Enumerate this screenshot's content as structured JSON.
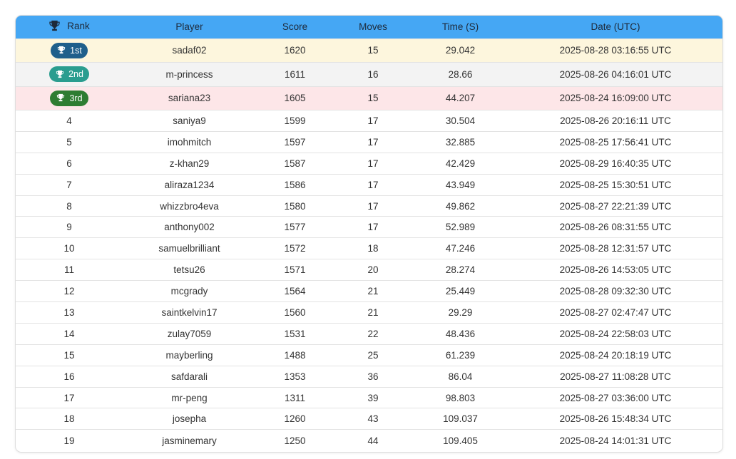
{
  "table": {
    "headers": {
      "rank": "Rank",
      "player": "Player",
      "score": "Score",
      "moves": "Moves",
      "time": "Time (S)",
      "date": "Date (UTC)"
    },
    "header_icon": "trophy-icon",
    "badge_icon": "trophy-icon",
    "colors": {
      "header_bg": "#45a7f4",
      "gold_row": "#fdf6dd",
      "silver_row": "#f3f3f3",
      "bronze_row": "#fde6e8",
      "badge_1st": "#1f5f8b",
      "badge_2nd": "#2a9d8f",
      "badge_3rd": "#2e7d32"
    },
    "rows": [
      {
        "rank": "1st",
        "player": "sadaf02",
        "score": "1620",
        "moves": "15",
        "time": "29.042",
        "date": "2025-08-28 03:16:55 UTC"
      },
      {
        "rank": "2nd",
        "player": "m-princess",
        "score": "1611",
        "moves": "16",
        "time": "28.66",
        "date": "2025-08-26 04:16:01 UTC"
      },
      {
        "rank": "3rd",
        "player": "sariana23",
        "score": "1605",
        "moves": "15",
        "time": "44.207",
        "date": "2025-08-24 16:09:00 UTC"
      },
      {
        "rank": "4",
        "player": "saniya9",
        "score": "1599",
        "moves": "17",
        "time": "30.504",
        "date": "2025-08-26 20:16:11 UTC"
      },
      {
        "rank": "5",
        "player": "imohmitch",
        "score": "1597",
        "moves": "17",
        "time": "32.885",
        "date": "2025-08-25 17:56:41 UTC"
      },
      {
        "rank": "6",
        "player": "z-khan29",
        "score": "1587",
        "moves": "17",
        "time": "42.429",
        "date": "2025-08-29 16:40:35 UTC"
      },
      {
        "rank": "7",
        "player": "aliraza1234",
        "score": "1586",
        "moves": "17",
        "time": "43.949",
        "date": "2025-08-25 15:30:51 UTC"
      },
      {
        "rank": "8",
        "player": "whizzbro4eva",
        "score": "1580",
        "moves": "17",
        "time": "49.862",
        "date": "2025-08-27 22:21:39 UTC"
      },
      {
        "rank": "9",
        "player": "anthony002",
        "score": "1577",
        "moves": "17",
        "time": "52.989",
        "date": "2025-08-26 08:31:55 UTC"
      },
      {
        "rank": "10",
        "player": "samuelbrilliant",
        "score": "1572",
        "moves": "18",
        "time": "47.246",
        "date": "2025-08-28 12:31:57 UTC"
      },
      {
        "rank": "11",
        "player": "tetsu26",
        "score": "1571",
        "moves": "20",
        "time": "28.274",
        "date": "2025-08-26 14:53:05 UTC"
      },
      {
        "rank": "12",
        "player": "mcgrady",
        "score": "1564",
        "moves": "21",
        "time": "25.449",
        "date": "2025-08-28 09:32:30 UTC"
      },
      {
        "rank": "13",
        "player": "saintkelvin17",
        "score": "1560",
        "moves": "21",
        "time": "29.29",
        "date": "2025-08-27 02:47:47 UTC"
      },
      {
        "rank": "14",
        "player": "zulay7059",
        "score": "1531",
        "moves": "22",
        "time": "48.436",
        "date": "2025-08-24 22:58:03 UTC"
      },
      {
        "rank": "15",
        "player": "mayberling",
        "score": "1488",
        "moves": "25",
        "time": "61.239",
        "date": "2025-08-24 20:18:19 UTC"
      },
      {
        "rank": "16",
        "player": "safdarali",
        "score": "1353",
        "moves": "36",
        "time": "86.04",
        "date": "2025-08-27 11:08:28 UTC"
      },
      {
        "rank": "17",
        "player": "mr-peng",
        "score": "1311",
        "moves": "39",
        "time": "98.803",
        "date": "2025-08-27 03:36:00 UTC"
      },
      {
        "rank": "18",
        "player": "josepha",
        "score": "1260",
        "moves": "43",
        "time": "109.037",
        "date": "2025-08-26 15:48:34 UTC"
      },
      {
        "rank": "19",
        "player": "jasminemary",
        "score": "1250",
        "moves": "44",
        "time": "109.405",
        "date": "2025-08-24 14:01:31 UTC"
      }
    ]
  }
}
